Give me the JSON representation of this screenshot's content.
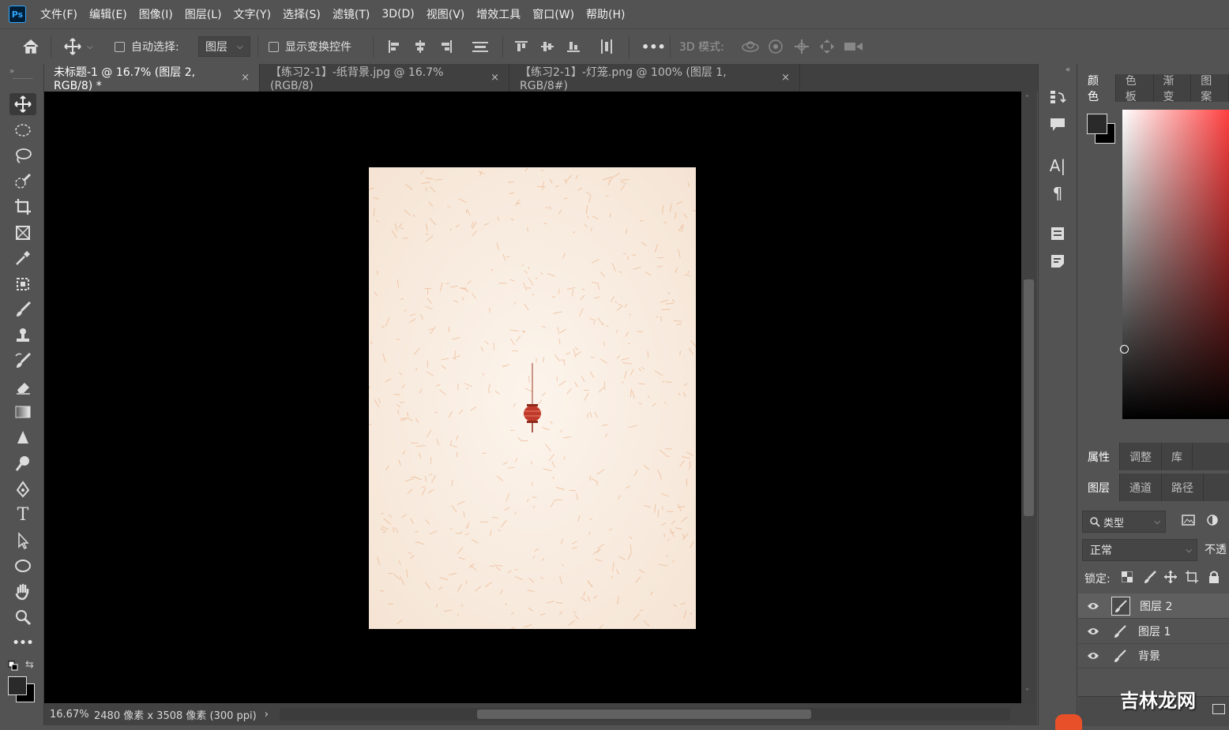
{
  "menubar": {
    "logo": "Ps",
    "items": [
      "文件(F)",
      "编辑(E)",
      "图像(I)",
      "图层(L)",
      "文字(Y)",
      "选择(S)",
      "滤镜(T)",
      "3D(D)",
      "视图(V)",
      "增效工具",
      "窗口(W)",
      "帮助(H)"
    ]
  },
  "options": {
    "auto_select_label": "自动选择:",
    "auto_select_value": "图层",
    "show_transform_label": "显示变换控件",
    "more": "•••",
    "mode_3d_label": "3D 模式:"
  },
  "tabs": [
    {
      "label": "未标题-1 @ 16.7% (图层 2, RGB/8) *",
      "close": "×"
    },
    {
      "label": "【练习2-1】-纸背景.jpg @ 16.7%(RGB/8)",
      "close": "×"
    },
    {
      "label": "【练习2-1】-灯笼.png @ 100% (图层 1, RGB/8#)",
      "close": "×"
    }
  ],
  "status": {
    "zoom": "16.67%",
    "doc_info": "2480 像素 x 3508 像素 (300 ppi)",
    "arrow": "›"
  },
  "color_panel": {
    "tabs": [
      "颜色",
      "色板",
      "渐变",
      "图案"
    ]
  },
  "properties_panel": {
    "tabs": [
      "属性",
      "调整",
      "库"
    ]
  },
  "layers_panel": {
    "tabs": [
      "图层",
      "通道",
      "路径"
    ],
    "filter_kind": "类型",
    "blend_mode": "正常",
    "opacity_label": "不透",
    "lock_label": "锁定:",
    "layers": [
      {
        "name": "图层 2",
        "selected": true
      },
      {
        "name": "图层 1",
        "selected": false
      },
      {
        "name": "背景",
        "selected": false
      }
    ]
  },
  "watermark": "吉林龙网",
  "colors": {
    "ui_bg": "#535353",
    "tab_bg": "#404040",
    "canvas_bg": "#000000",
    "paper": "#f9ede2",
    "lantern": "#c0392b",
    "accent": "#31a8ff"
  }
}
